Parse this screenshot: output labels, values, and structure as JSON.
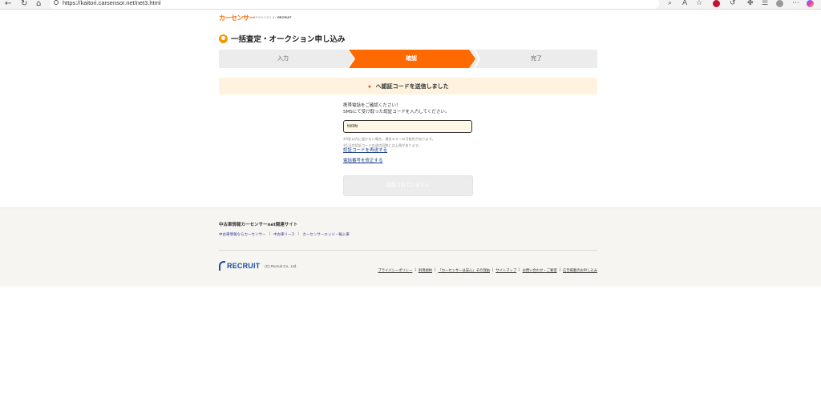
{
  "browser": {
    "url": "https://kaitori.carsensor.net/net3.html",
    "back_icon": "back-arrow-icon",
    "refresh_icon": "refresh-icon",
    "home_icon": "home-icon"
  },
  "header": {
    "logo_text": "カーセンサー",
    "produced_by": "PRODUCED BY",
    "produced_brand": "RECRUIT"
  },
  "page_title": "一括査定・オークション申し込み",
  "steps": [
    {
      "label": "入力",
      "active": false
    },
    {
      "label": "確認",
      "active": true
    },
    {
      "label": "完了",
      "active": false
    }
  ],
  "notice": {
    "icon": "★",
    "text": "へ認証コードを送信しました"
  },
  "instructions": {
    "line1": "携帯電話をご確認ください！",
    "line2": "SMSにて受け取った認証コードを入力してください。"
  },
  "code_input": {
    "value": "6896"
  },
  "notes": {
    "line1": "※5秒以内に届かない場合、通信エラーの可能性があります。",
    "line2": "※1日の認証コードの送信回数には上限があります。"
  },
  "links": {
    "resend": "認証コードを再送する",
    "edit_phone": "電話番号を修正する"
  },
  "submit_label": "認証されていません",
  "footer": {
    "title": "中古車情報カーセンサーnet関連サイト",
    "links": [
      "中古車情報ならカーセンサー",
      "中古車リース",
      "カーセンサーエッジ・輸入車"
    ],
    "brand": "RECRUIT",
    "copyright": "(C) Recruit Co., Ltd.",
    "bottom_links": [
      "プライバシーポリシー",
      "利用規約",
      "「カーセンサーは安心」その理由",
      "サイトマップ",
      "お問い合わせ・ご要望",
      "広告掲載のお申し込み"
    ]
  }
}
